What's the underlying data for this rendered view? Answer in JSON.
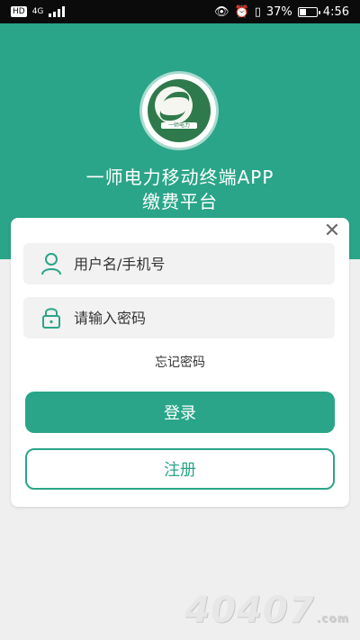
{
  "status_bar": {
    "hd": "HD",
    "network": "4G",
    "battery_percent": "37%",
    "battery_level": 0.37,
    "time": "4:56"
  },
  "header": {
    "logo_text": "一师电力",
    "title_line1": "一师电力移动终端APP",
    "title_line2": "缴费平台"
  },
  "login_card": {
    "username_placeholder": "用户名/手机号",
    "password_placeholder": "请输入密码",
    "forgot_label": "忘记密码",
    "login_label": "登录",
    "register_label": "注册"
  },
  "colors": {
    "primary": "#2aa589",
    "status_bar": "#0b0b0b",
    "field_bg": "#f2f2f2"
  },
  "icons": [
    "close-icon",
    "user-icon",
    "lock-icon"
  ],
  "watermark": {
    "text": "40407",
    "suffix": ".com"
  }
}
